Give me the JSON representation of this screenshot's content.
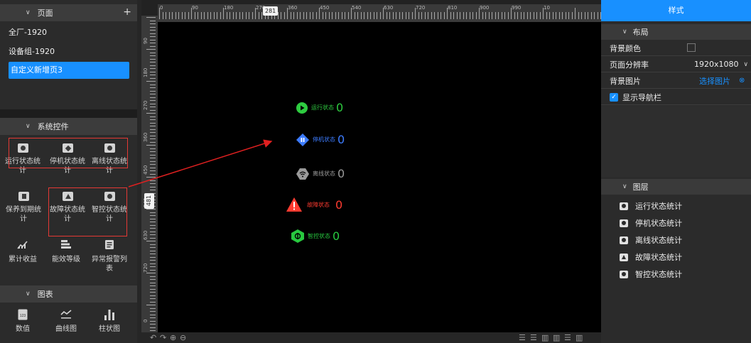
{
  "left": {
    "pages_header": "页面",
    "pages_add": "+",
    "pages": [
      "全厂-1920",
      "设备组-1920",
      "自定义新增页3"
    ],
    "system_header": "系统控件",
    "controls": [
      {
        "label": "运行状态统计",
        "icon": "run-status-icon"
      },
      {
        "label": "停机状态统计",
        "icon": "stop-status-icon"
      },
      {
        "label": "离线状态统计",
        "icon": "offline-status-icon"
      },
      {
        "label": "保养到期统计",
        "icon": "maintenance-icon"
      },
      {
        "label": "故障状态统计",
        "icon": "fault-status-icon"
      },
      {
        "label": "智控状态统计",
        "icon": "smart-control-icon"
      },
      {
        "label": "累计收益",
        "icon": "cumulative-revenue-icon"
      },
      {
        "label": "能效等级",
        "icon": "efficiency-level-icon"
      },
      {
        "label": "异常报警列表",
        "icon": "alarm-list-icon"
      }
    ],
    "chart_header": "图表",
    "chart_items": [
      {
        "label": "数值",
        "icon": "numeric-icon"
      },
      {
        "label": "曲线图",
        "icon": "line-chart-icon"
      },
      {
        "label": "柱状图",
        "icon": "bar-chart-icon"
      }
    ]
  },
  "ruler": {
    "h_labels": [
      "0",
      "90",
      "180",
      "270",
      "360",
      "450",
      "540",
      "630",
      "720",
      "810",
      "900",
      "990",
      "10"
    ],
    "h_marker": "281",
    "v_labels": [
      "90",
      "180",
      "270",
      "360",
      "450",
      "540",
      "630",
      "720",
      "0"
    ],
    "v_marker": "481"
  },
  "canvas": {
    "widgets": [
      {
        "label": "运行状态",
        "value": "0",
        "color": "#2ecc40",
        "icon": "play-circle-icon"
      },
      {
        "label": "停机状态",
        "value": "0",
        "color": "#3d7cff",
        "icon": "pause-diamond-icon"
      },
      {
        "label": "离线状态",
        "value": "0",
        "color": "#9a9a9a",
        "icon": "wifi-off-icon"
      },
      {
        "label": "故障状态",
        "value": "0",
        "color": "#ff3b30",
        "icon": "warning-triangle-icon"
      },
      {
        "label": "智控状态",
        "value": "0",
        "color": "#27c93f",
        "icon": "smart-hex-icon"
      }
    ]
  },
  "right": {
    "tab": "样式",
    "layout_header": "布局",
    "bg_color_label": "背景颜色",
    "resolution_label": "页面分辨率",
    "resolution_value": "1920x1080",
    "bg_image_label": "背景图片",
    "bg_image_action": "选择图片",
    "show_nav_label": "显示导航栏",
    "layers_header": "图层",
    "layers": [
      "运行状态统计",
      "停机状态统计",
      "离线状态统计",
      "故障状态统计",
      "智控状态统计"
    ]
  },
  "colors": {
    "accent": "#1890ff",
    "highlight_box": "#e53935",
    "arrow": "#e02020"
  }
}
